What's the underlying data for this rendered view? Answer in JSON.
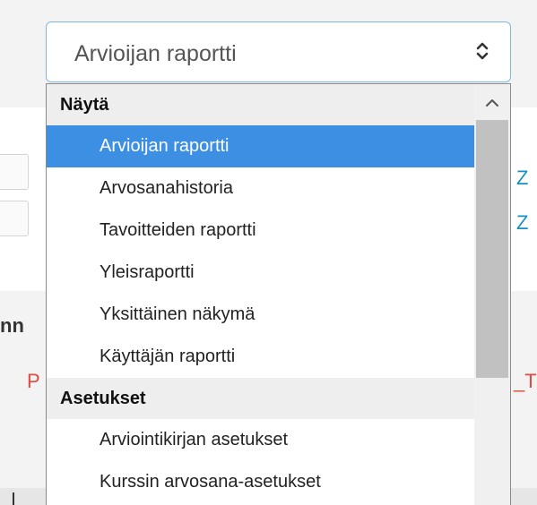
{
  "select": {
    "value": "Arvioijan raportti",
    "arrows_icon": "up-down-chevrons-icon"
  },
  "dropdown": {
    "groups": [
      {
        "label": "Näytä",
        "options": [
          {
            "label": "Arvioijan raportti",
            "selected": true
          },
          {
            "label": "Arvosanahistoria",
            "selected": false
          },
          {
            "label": "Tavoitteiden raportti",
            "selected": false
          },
          {
            "label": "Yleisraportti",
            "selected": false
          },
          {
            "label": "Yksittäinen näkymä",
            "selected": false
          },
          {
            "label": "Käyttäjän raportti",
            "selected": false
          }
        ]
      },
      {
        "label": "Asetukset",
        "options": [
          {
            "label": "Arviointikirjan asetukset",
            "selected": false
          },
          {
            "label": "Kurssin arvosana-asetukset",
            "selected": false
          }
        ]
      }
    ],
    "scroll_up_icon": "chevron-up-icon"
  },
  "background": {
    "link_1": "Z",
    "link_2": "Z",
    "fragment_bold": "nn",
    "fragment_red_left": "P",
    "fragment_red_right": "_T"
  },
  "colors": {
    "selected_bg": "#3d8fe4",
    "focus_border": "#7fb6e6",
    "link": "#1a8fc4",
    "error_text": "#e04a3f"
  }
}
